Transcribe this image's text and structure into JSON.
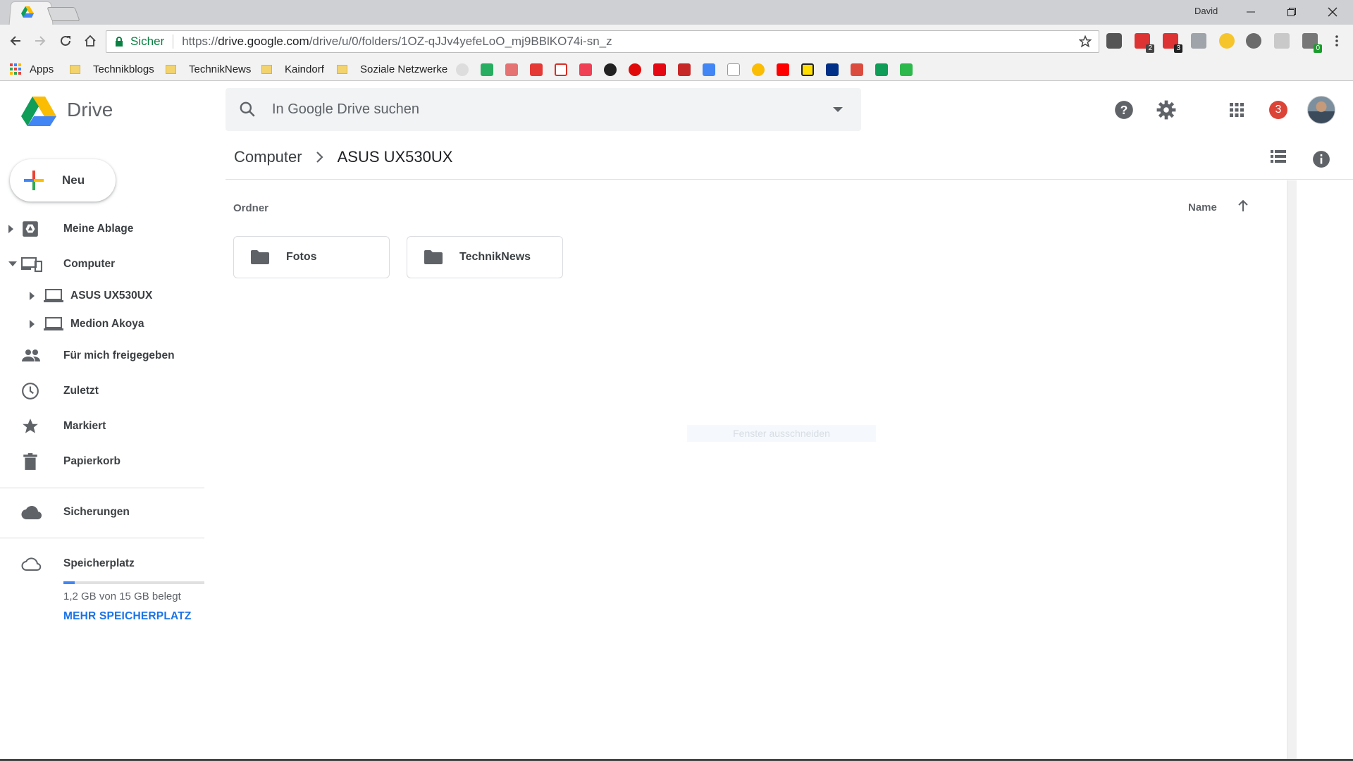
{
  "browser": {
    "profile_name": "David",
    "secure_label": "Sicher",
    "url_scheme": "https://",
    "url_host": "drive.google.com",
    "url_path": "/drive/u/0/folders/1OZ-qJJv4yefeLoO_mj9BBlKO74i-sn_z",
    "extension_badges": [
      "2",
      "3",
      "0"
    ]
  },
  "bookmarks": [
    {
      "label": "Apps"
    },
    {
      "label": "Technikblogs"
    },
    {
      "label": "TechnikNews"
    },
    {
      "label": "Kaindorf"
    },
    {
      "label": "Soziale Netzwerke"
    }
  ],
  "app": {
    "name": "Drive",
    "search_placeholder": "In Google Drive suchen",
    "notification_count": "3"
  },
  "sidebar": {
    "new_label": "Neu",
    "items": [
      {
        "label": "Meine Ablage",
        "icon": "my-drive-icon"
      },
      {
        "label": "Computer",
        "icon": "computers-icon"
      },
      {
        "label": "ASUS UX530UX",
        "icon": "laptop-icon"
      },
      {
        "label": "Medion Akoya",
        "icon": "laptop-icon"
      },
      {
        "label": "Für mich freigegeben",
        "icon": "people-icon"
      },
      {
        "label": "Zuletzt",
        "icon": "clock-icon"
      },
      {
        "label": "Markiert",
        "icon": "star-icon"
      },
      {
        "label": "Papierkorb",
        "icon": "trash-icon"
      },
      {
        "label": "Sicherungen",
        "icon": "cloud-icon"
      },
      {
        "label": "Speicherplatz",
        "icon": "cloud-outline-icon"
      }
    ],
    "storage_used_fraction": 0.08,
    "storage_text": "1,2 GB von 15 GB belegt",
    "storage_link": "MEHR SPEICHERPLATZ"
  },
  "main": {
    "breadcrumb": [
      "Computer",
      "ASUS UX530UX"
    ],
    "section_label": "Ordner",
    "sort_label": "Name",
    "folders": [
      {
        "name": "Fotos"
      },
      {
        "name": "TechnikNews"
      }
    ],
    "tooltip": "Fenster ausschneiden"
  },
  "colors": {
    "accent_blue": "#1a73e8",
    "secure_green": "#0b8043",
    "badge_red": "#db4437"
  }
}
